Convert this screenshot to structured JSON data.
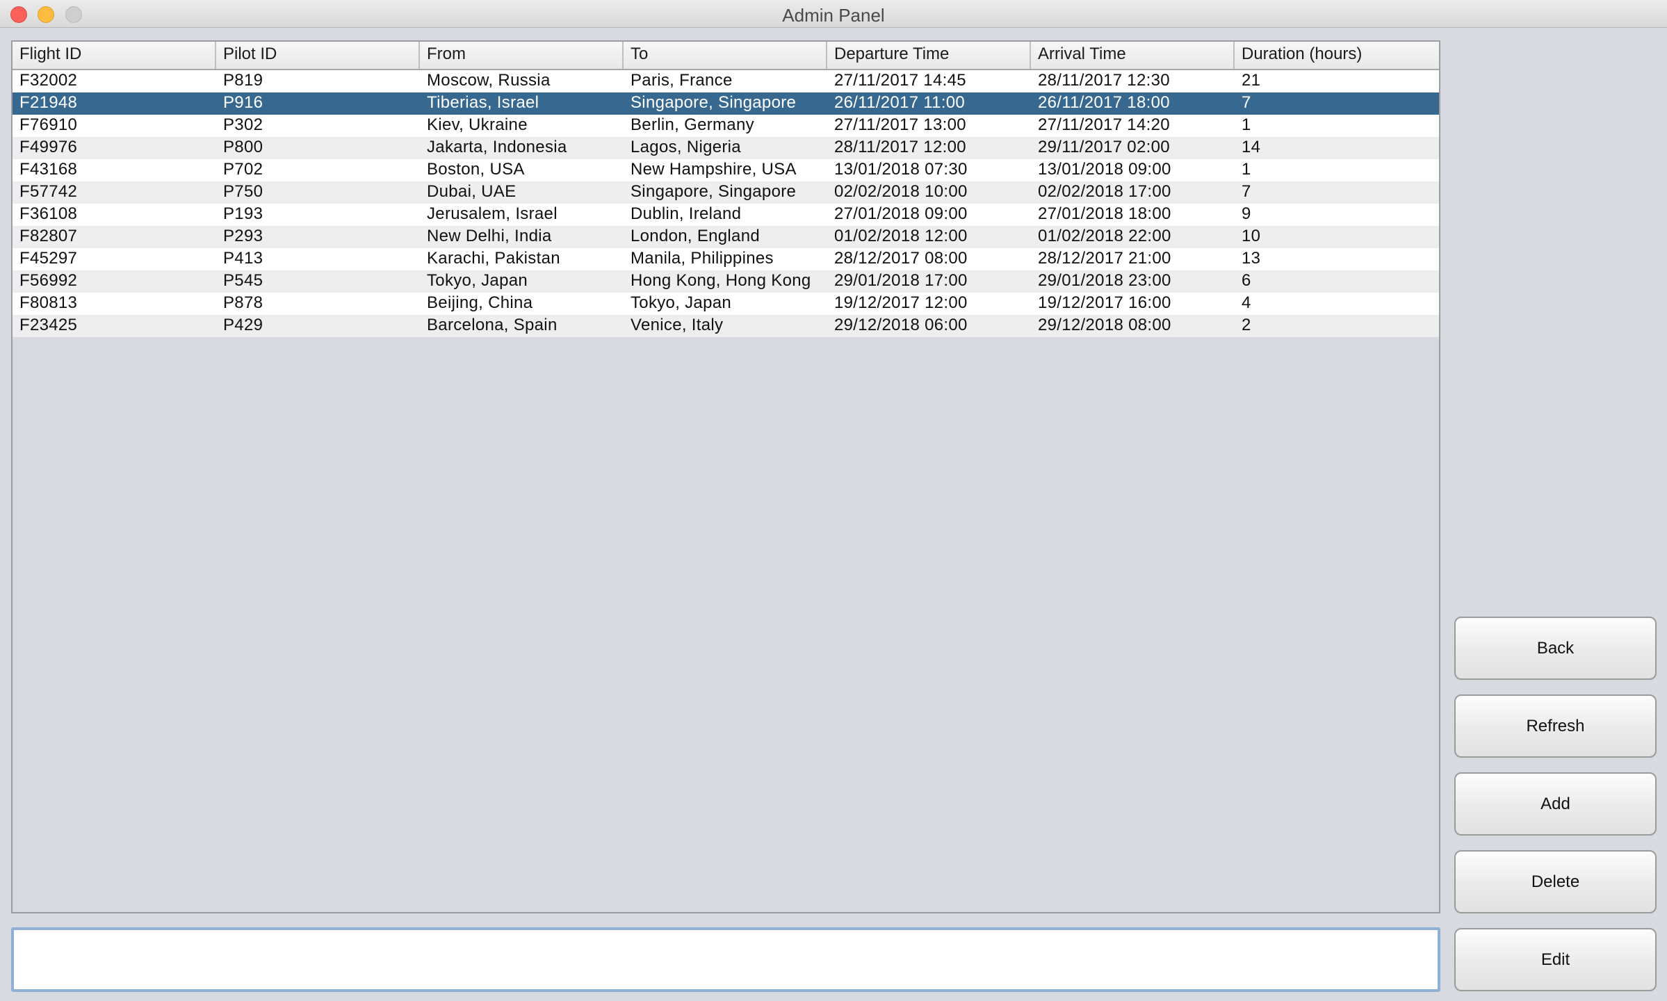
{
  "window": {
    "title": "Admin Panel"
  },
  "table": {
    "columns": [
      "Flight ID",
      "Pilot ID",
      "From",
      "To",
      "Departure Time",
      "Arrival Time",
      "Duration (hours)"
    ],
    "rows": [
      [
        "F32002",
        "P819",
        "Moscow, Russia",
        "Paris, France",
        "27/11/2017 14:45",
        "28/11/2017 12:30",
        "21"
      ],
      [
        "F21948",
        "P916",
        "Tiberias, Israel",
        "Singapore, Singapore",
        "26/11/2017 11:00",
        "26/11/2017 18:00",
        "7"
      ],
      [
        "F76910",
        "P302",
        "Kiev, Ukraine",
        "Berlin, Germany",
        "27/11/2017 13:00",
        "27/11/2017 14:20",
        "1"
      ],
      [
        "F49976",
        "P800",
        "Jakarta, Indonesia",
        "Lagos, Nigeria",
        "28/11/2017 12:00",
        "29/11/2017 02:00",
        "14"
      ],
      [
        "F43168",
        "P702",
        "Boston, USA",
        "New Hampshire, USA",
        "13/01/2018 07:30",
        "13/01/2018 09:00",
        "1"
      ],
      [
        "F57742",
        "P750",
        "Dubai, UAE",
        "Singapore, Singapore",
        "02/02/2018 10:00",
        "02/02/2018 17:00",
        "7"
      ],
      [
        "F36108",
        "P193",
        "Jerusalem, Israel",
        "Dublin, Ireland",
        "27/01/2018 09:00",
        "27/01/2018 18:00",
        "9"
      ],
      [
        "F82807",
        "P293",
        "New Delhi, India",
        "London, England",
        "01/02/2018 12:00",
        "01/02/2018 22:00",
        "10"
      ],
      [
        "F45297",
        "P413",
        "Karachi, Pakistan",
        "Manila, Philippines",
        "28/12/2017 08:00",
        "28/12/2017 21:00",
        "13"
      ],
      [
        "F56992",
        "P545",
        "Tokyo, Japan",
        "Hong Kong, Hong Kong",
        "29/01/2018 17:00",
        "29/01/2018 23:00",
        "6"
      ],
      [
        "F80813",
        "P878",
        "Beijing, China",
        "Tokyo, Japan",
        "19/12/2017 12:00",
        "19/12/2017 16:00",
        "4"
      ],
      [
        "F23425",
        "P429",
        "Barcelona, Spain",
        "Venice, Italy",
        "29/12/2018 06:00",
        "29/12/2018 08:00",
        "2"
      ]
    ],
    "selected_row": 1
  },
  "input": {
    "value": "",
    "placeholder": ""
  },
  "buttons": {
    "back": "Back",
    "refresh": "Refresh",
    "add": "Add",
    "delete": "Delete",
    "edit": "Edit"
  },
  "colors": {
    "selection": "#376890",
    "background": "#d8dae1",
    "focus_border": "#8fb0d5"
  }
}
